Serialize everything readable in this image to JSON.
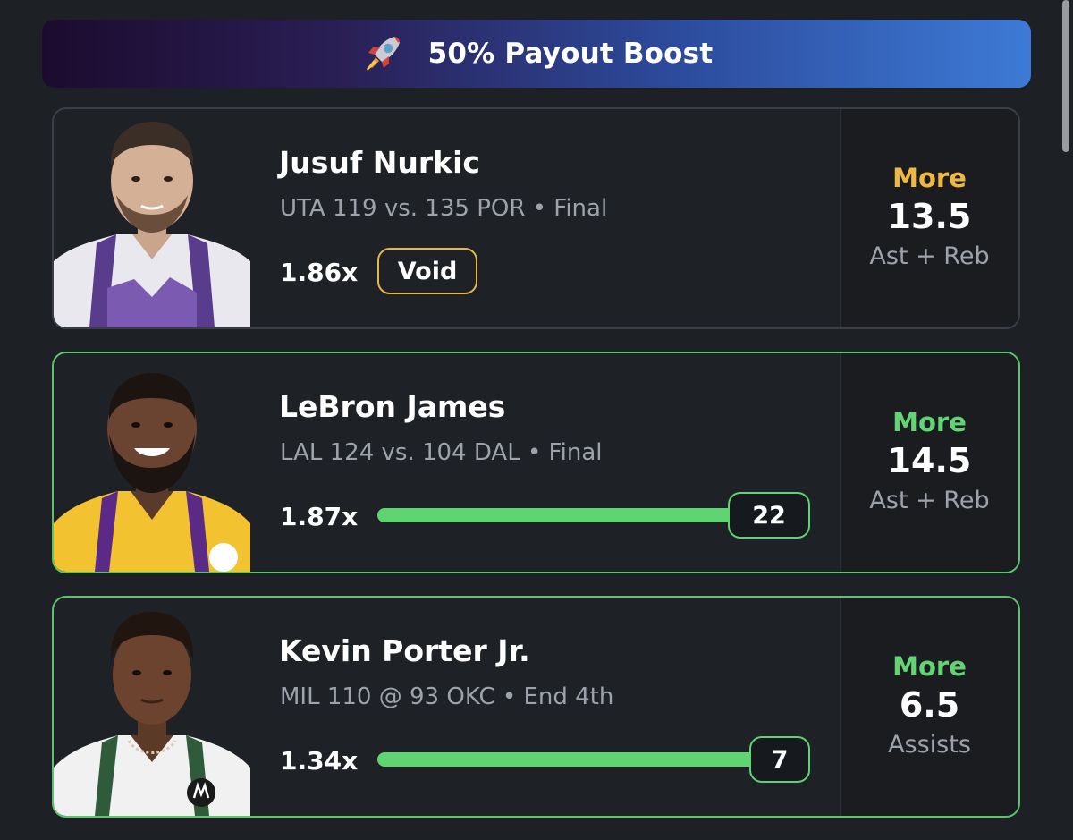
{
  "banner": {
    "icon": "rocket-icon",
    "title": "50% Payout Boost"
  },
  "colors": {
    "background": "#1d2024",
    "accent_green": "#5fd470",
    "accent_gold": "#f0b842",
    "banner_gradient_start": "#1c0b2e",
    "banner_gradient_end": "#3d7ad6"
  },
  "picks": [
    {
      "name": "Jusuf Nurkic",
      "game": "UTA 119 vs. 135 POR • Final",
      "multiplier": "1.86x",
      "status": "Void",
      "direction": "More",
      "line": "13.5",
      "stat": "Ast + Reb"
    },
    {
      "name": "LeBron James",
      "game": "LAL 124 vs. 104 DAL • Final",
      "multiplier": "1.87x",
      "current_value": "22",
      "progress": 1.0,
      "direction": "More",
      "line": "14.5",
      "stat": "Ast + Reb"
    },
    {
      "name": "Kevin Porter Jr.",
      "game": "MIL 110 @ 93 OKC • End 4th",
      "multiplier": "1.34x",
      "current_value": "7",
      "progress": 1.0,
      "direction": "More",
      "line": "6.5",
      "stat": "Assists"
    }
  ]
}
